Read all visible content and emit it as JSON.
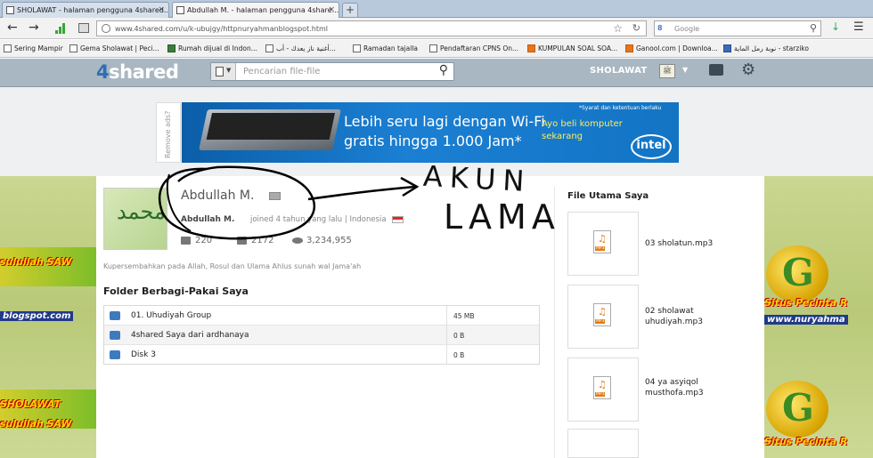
{
  "browser": {
    "tabs": [
      {
        "label": "SHOLAWAT - halaman pengguna 4shared..."
      },
      {
        "label": "Abdullah M. - halaman pengguna 4share..."
      }
    ],
    "new_tab": "+",
    "url": "www.4shared.com/u/k-ubujgy/httpnuryahmanblogspot.html",
    "search_engine": "Google",
    "search_placeholder": "Google"
  },
  "bookmarks": [
    {
      "label": "Sering Mampir",
      "color": "c"
    },
    {
      "label": "Gema Sholawat | Peci...",
      "color": "c"
    },
    {
      "label": "Rumah dijual di Indon...",
      "color": "g"
    },
    {
      "label": "أغنية ناز يعدك - أب...",
      "color": "c"
    },
    {
      "label": "Ramadan tajalla",
      "color": "c"
    },
    {
      "label": "Pendaftaran CPNS On...",
      "color": "c"
    },
    {
      "label": "KUMPULAN SOAL SOA...",
      "color": "o"
    },
    {
      "label": "Ganool.com | Downloa...",
      "color": "o"
    },
    {
      "label": "نوبة رمل الماية - starziko",
      "color": "b"
    }
  ],
  "header": {
    "logo_num": "4",
    "logo_text": "shared",
    "search_placeholder": "Pencarian file-file",
    "username": "SHOLAWAT"
  },
  "ad": {
    "remove": "Remove ads?",
    "headline1": "Lebih seru lagi dengan Wi-Fi",
    "headline2": "gratis hingga 1.000 Jam*",
    "terms": "*Syarat dan ketentuan berlaku",
    "cta1": "Ayo beli komputer",
    "cta2": "sekarang",
    "brand": "intel"
  },
  "profile": {
    "name": "Abdullah M.",
    "short_name": "Abdullah M.",
    "joined": "joined 4 tahun yang lalu | Indonesia",
    "stats": {
      "files": "220",
      "followers": "2172",
      "views": "3,234,955"
    },
    "description": "Kupersembahkan pada Allah, Rosul dan Ulama Ahlus sunah wal Jama'ah"
  },
  "folders": {
    "title": "Folder Berbagi-Pakai Saya",
    "rows": [
      {
        "name": "01. Uhudiyah Group",
        "size": "45 MB"
      },
      {
        "name": "4shared Saya dari ardhanaya",
        "size": "0 B"
      },
      {
        "name": "Disk 3",
        "size": "0 B"
      }
    ]
  },
  "main_files": {
    "title": "File Utama Saya",
    "icon_label": "MP3",
    "items": [
      {
        "name": "03 sholatun.mp3"
      },
      {
        "name": "02 sholawat uhudiyah.mp3"
      },
      {
        "name": "04 ya asyiqol musthofa.mp3"
      }
    ]
  },
  "annotation": {
    "line1": "AKUN",
    "line2": "LAMA"
  },
  "wallpaper": {
    "text1": "sulullah SAW",
    "text2": "blogspot.com",
    "text3": "Situs Pecinta R",
    "text4": "www.nuryahma",
    "text5": "SHOLAWAT"
  },
  "colors": {
    "header_bg": "#a9b7c2",
    "ad_bg": "#1374c4",
    "link_blue": "#3d7bbf",
    "mp3_orange": "#e07b12"
  }
}
